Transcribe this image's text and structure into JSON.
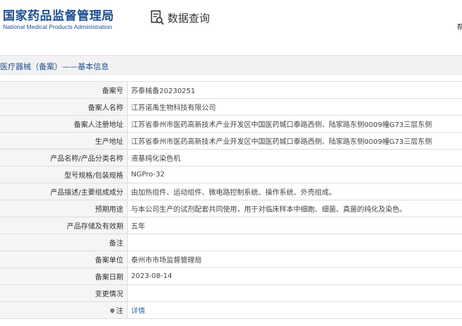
{
  "header": {
    "title_cn": "国家药品监督管理局",
    "title_en": "National Medical Products Administration",
    "query_label": "数据查询",
    "corner_top": "",
    "corner_bottom": "帮"
  },
  "breadcrumb": "医疗器械（备案）——基本信息",
  "rows": [
    {
      "label": "备案号",
      "value": "苏泰械备20230251"
    },
    {
      "label": "备案人名称",
      "value": "江苏诺禹生物科技有限公司"
    },
    {
      "label": "备案人注册地址",
      "value": "江苏省泰州市医药高新技术产业开发区中国医药城口泰路西侧、陆家路东侧0009幢G73三层东侧"
    },
    {
      "label": "生产地址",
      "value": "江苏省泰州市医药高新技术产业开发区中国医药城口泰路西侧、陆家路东侧0009幢G73三层东侧"
    },
    {
      "label": "产品名称/产品分类名称",
      "value": "液基纯化染色机"
    },
    {
      "label": "型号规格/包装规格",
      "value": "NGPro-32"
    },
    {
      "label": "产品描述/主要组成成分",
      "value": "由加热组件、运动组件、微电路控制系统、操作系统、外壳组成。"
    },
    {
      "label": "预期用途",
      "value": "与本公司生产的试剂配套共同使用，用于对临床样本中细胞、细菌、真菌的纯化及染色。"
    },
    {
      "label": "产品存储及有效期",
      "value": "五年"
    },
    {
      "label": "备注",
      "value": ""
    },
    {
      "label": "备案单位",
      "value": "泰州市市场监督管理局"
    },
    {
      "label": "备案日期",
      "value": "2023-08-14"
    },
    {
      "label": "变更情况",
      "value": ""
    }
  ],
  "note_row": {
    "label": "注",
    "link": "详情"
  }
}
